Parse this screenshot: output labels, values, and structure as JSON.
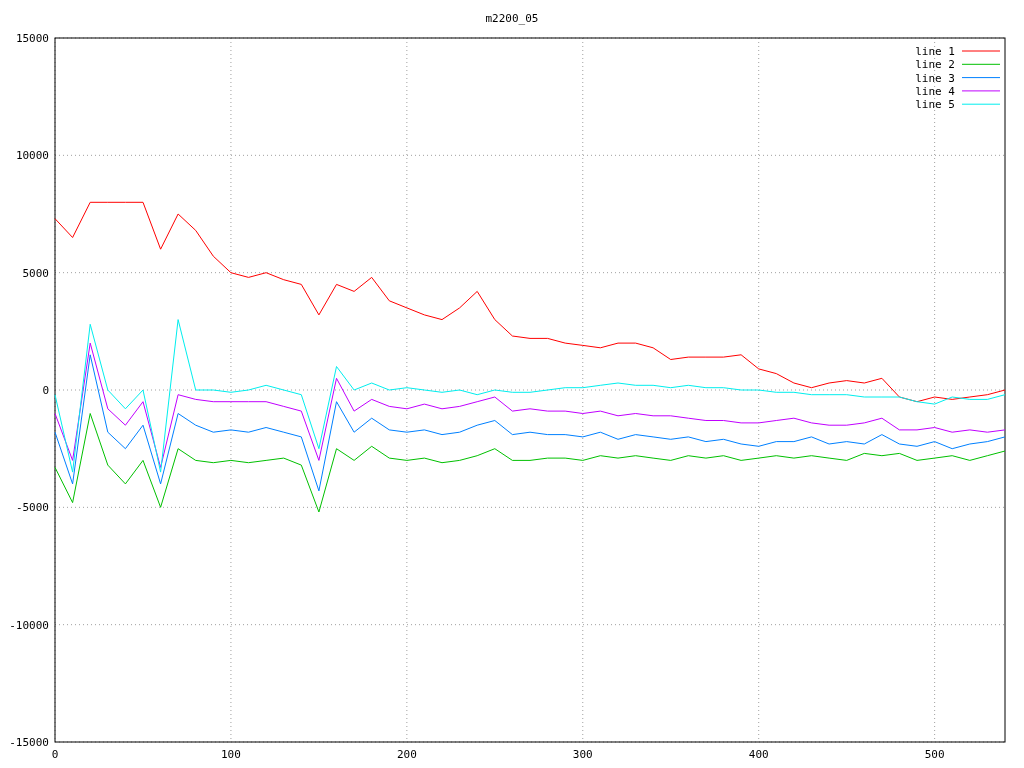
{
  "chart_data": {
    "type": "line",
    "title": "m2200_05",
    "grid": true,
    "legend": true,
    "xlim": [
      0,
      540
    ],
    "ylim": [
      -15000,
      15000
    ],
    "xticks": [
      0,
      100,
      200,
      300,
      400,
      500
    ],
    "yticks": [
      -15000,
      -10000,
      -5000,
      0,
      5000,
      10000,
      15000
    ],
    "x": [
      0,
      10,
      20,
      30,
      40,
      50,
      60,
      70,
      80,
      90,
      100,
      110,
      120,
      130,
      140,
      150,
      160,
      170,
      180,
      190,
      200,
      210,
      220,
      230,
      240,
      250,
      260,
      270,
      280,
      290,
      300,
      310,
      320,
      330,
      340,
      350,
      360,
      370,
      380,
      390,
      400,
      410,
      420,
      430,
      440,
      450,
      460,
      470,
      480,
      490,
      500,
      510,
      520,
      530,
      540
    ],
    "series": [
      {
        "name": "line 1",
        "color": "#ff0000",
        "values": [
          7300,
          6500,
          8000,
          8000,
          8000,
          8000,
          6000,
          7500,
          6800,
          5700,
          5000,
          4800,
          5000,
          4700,
          4500,
          3200,
          4500,
          4200,
          4800,
          3800,
          3500,
          3200,
          3000,
          3500,
          4200,
          3000,
          2300,
          2200,
          2200,
          2000,
          1900,
          1800,
          2000,
          2000,
          1800,
          1300,
          1400,
          1400,
          1400,
          1500,
          900,
          700,
          300,
          100,
          300,
          400,
          300,
          500,
          -300,
          -500,
          -300,
          -400,
          -300,
          -200,
          0
        ]
      },
      {
        "name": "line 2",
        "color": "#00c000",
        "values": [
          -3300,
          -4800,
          -1000,
          -3200,
          -4000,
          -3000,
          -5000,
          -2500,
          -3000,
          -3100,
          -3000,
          -3100,
          -3000,
          -2900,
          -3200,
          -5200,
          -2500,
          -3000,
          -2400,
          -2900,
          -3000,
          -2900,
          -3100,
          -3000,
          -2800,
          -2500,
          -3000,
          -3000,
          -2900,
          -2900,
          -3000,
          -2800,
          -2900,
          -2800,
          -2900,
          -3000,
          -2800,
          -2900,
          -2800,
          -3000,
          -2900,
          -2800,
          -2900,
          -2800,
          -2900,
          -3000,
          -2700,
          -2800,
          -2700,
          -3000,
          -2900,
          -2800,
          -3000,
          -2800,
          -2600
        ]
      },
      {
        "name": "line 3",
        "color": "#0080ff",
        "values": [
          -1800,
          -4000,
          1500,
          -1800,
          -2500,
          -1500,
          -4000,
          -1000,
          -1500,
          -1800,
          -1700,
          -1800,
          -1600,
          -1800,
          -2000,
          -4300,
          -500,
          -1800,
          -1200,
          -1700,
          -1800,
          -1700,
          -1900,
          -1800,
          -1500,
          -1300,
          -1900,
          -1800,
          -1900,
          -1900,
          -2000,
          -1800,
          -2100,
          -1900,
          -2000,
          -2100,
          -2000,
          -2200,
          -2100,
          -2300,
          -2400,
          -2200,
          -2200,
          -2000,
          -2300,
          -2200,
          -2300,
          -1900,
          -2300,
          -2400,
          -2200,
          -2500,
          -2300,
          -2200,
          -2000
        ]
      },
      {
        "name": "line 4",
        "color": "#c000ff",
        "values": [
          -1000,
          -3000,
          2000,
          -800,
          -1500,
          -500,
          -3300,
          -200,
          -400,
          -500,
          -500,
          -500,
          -500,
          -700,
          -900,
          -3000,
          500,
          -900,
          -400,
          -700,
          -800,
          -600,
          -800,
          -700,
          -500,
          -300,
          -900,
          -800,
          -900,
          -900,
          -1000,
          -900,
          -1100,
          -1000,
          -1100,
          -1100,
          -1200,
          -1300,
          -1300,
          -1400,
          -1400,
          -1300,
          -1200,
          -1400,
          -1500,
          -1500,
          -1400,
          -1200,
          -1700,
          -1700,
          -1600,
          -1800,
          -1700,
          -1800,
          -1700
        ]
      },
      {
        "name": "line 5",
        "color": "#00eeee",
        "values": [
          -200,
          -3500,
          2800,
          0,
          -800,
          0,
          -3500,
          3000,
          0,
          0,
          -100,
          0,
          200,
          0,
          -200,
          -2500,
          1000,
          0,
          300,
          0,
          100,
          0,
          -100,
          0,
          -200,
          0,
          -100,
          -100,
          0,
          100,
          100,
          200,
          300,
          200,
          200,
          100,
          200,
          100,
          100,
          0,
          0,
          -100,
          -100,
          -200,
          -200,
          -200,
          -300,
          -300,
          -300,
          -500,
          -600,
          -300,
          -400,
          -400,
          -200
        ]
      }
    ]
  }
}
